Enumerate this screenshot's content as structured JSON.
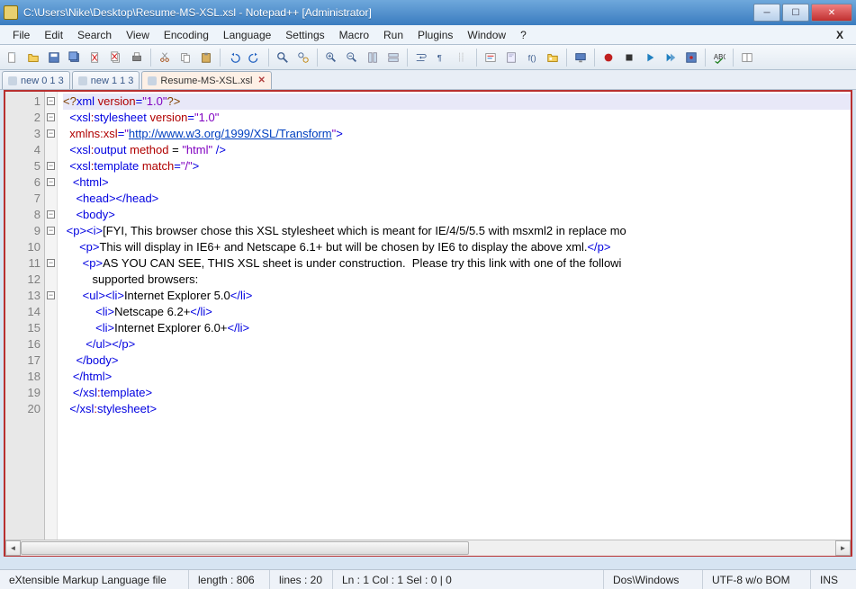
{
  "window": {
    "title": "C:\\Users\\Nike\\Desktop\\Resume-MS-XSL.xsl - Notepad++ [Administrator]"
  },
  "menu": {
    "items": [
      "File",
      "Edit",
      "Search",
      "View",
      "Encoding",
      "Language",
      "Settings",
      "Macro",
      "Run",
      "Plugins",
      "Window",
      "?"
    ]
  },
  "toolbar_icons": [
    "new-file-icon",
    "open-folder-icon",
    "save-icon",
    "save-all-icon",
    "close-icon",
    "close-all-icon",
    "print-icon",
    "sep",
    "cut-icon",
    "copy-icon",
    "paste-icon",
    "sep",
    "undo-icon",
    "redo-icon",
    "sep",
    "find-icon",
    "replace-icon",
    "sep",
    "zoom-in-icon",
    "zoom-out-icon",
    "sync-v-icon",
    "sync-h-icon",
    "sep",
    "wrap-icon",
    "all-chars-icon",
    "indent-guide-icon",
    "sep",
    "lang-icon",
    "doc-map-icon",
    "func-list-icon",
    "folder-view-icon",
    "sep",
    "monitor-icon",
    "sep",
    "record-icon",
    "stop-icon",
    "play-icon",
    "play-multi-icon",
    "save-macro-icon",
    "sep",
    "spellcheck-icon",
    "sep",
    "doc-switch-icon"
  ],
  "tabs": [
    {
      "label": "new 0 1 3",
      "dirty": false,
      "active": false
    },
    {
      "label": "new 1 1 3",
      "dirty": false,
      "active": false
    },
    {
      "label": "Resume-MS-XSL.xsl",
      "dirty": false,
      "active": true
    }
  ],
  "code_lines": [
    {
      "n": 1,
      "fold": "-",
      "segs": [
        [
          "brown",
          "<?"
        ],
        [
          "blue",
          "xml "
        ],
        [
          "red",
          "version"
        ],
        [
          "blue",
          "="
        ],
        [
          "purple",
          "\"1.0\""
        ],
        [
          "brown",
          "?>"
        ]
      ]
    },
    {
      "n": 2,
      "fold": "-",
      "segs": [
        [
          "black",
          "  "
        ],
        [
          "blue",
          "<"
        ],
        [
          "blue",
          "xsl"
        ],
        [
          "red",
          ":"
        ],
        [
          "blue",
          "stylesheet "
        ],
        [
          "red",
          "version"
        ],
        [
          "blue",
          "="
        ],
        [
          "purple",
          "\"1.0\""
        ]
      ]
    },
    {
      "n": 3,
      "fold": "-",
      "segs": [
        [
          "black",
          "  "
        ],
        [
          "red",
          "xmlns:xsl"
        ],
        [
          "blue",
          "="
        ],
        [
          "purple",
          "\""
        ],
        [
          "link",
          "http://www.w3.org/1999/XSL/Transform"
        ],
        [
          "purple",
          "\""
        ],
        [
          "blue",
          ">"
        ]
      ]
    },
    {
      "n": 4,
      "fold": "",
      "segs": [
        [
          "black",
          "  "
        ],
        [
          "blue",
          "<"
        ],
        [
          "blue",
          "xsl"
        ],
        [
          "red",
          ":"
        ],
        [
          "blue",
          "output "
        ],
        [
          "red",
          "method"
        ],
        [
          "black",
          " = "
        ],
        [
          "purple",
          "\"html\""
        ],
        [
          "blue",
          " />"
        ]
      ]
    },
    {
      "n": 5,
      "fold": "-",
      "segs": [
        [
          "black",
          "  "
        ],
        [
          "blue",
          "<"
        ],
        [
          "blue",
          "xsl"
        ],
        [
          "red",
          ":"
        ],
        [
          "blue",
          "template "
        ],
        [
          "red",
          "match"
        ],
        [
          "blue",
          "="
        ],
        [
          "purple",
          "\"/\""
        ],
        [
          "blue",
          ">"
        ]
      ]
    },
    {
      "n": 6,
      "fold": "-",
      "segs": [
        [
          "black",
          "   "
        ],
        [
          "blue",
          "<html>"
        ]
      ]
    },
    {
      "n": 7,
      "fold": "",
      "segs": [
        [
          "black",
          "    "
        ],
        [
          "blue",
          "<head></head>"
        ]
      ]
    },
    {
      "n": 8,
      "fold": "-",
      "segs": [
        [
          "black",
          "    "
        ],
        [
          "blue",
          "<body>"
        ]
      ]
    },
    {
      "n": 9,
      "fold": "-",
      "segs": [
        [
          "black",
          " "
        ],
        [
          "blue",
          "<p><i>"
        ],
        [
          "black",
          "[FYI, This browser chose this XSL "
        ],
        [
          "black",
          "stylesheet"
        ],
        [
          "black",
          " which is meant for IE/4/5/5.5 with msxml2 in replace mo"
        ]
      ]
    },
    {
      "n": 10,
      "fold": "",
      "segs": [
        [
          "black",
          "     "
        ],
        [
          "blue",
          "<p>"
        ],
        [
          "black",
          "This will display in IE6+ and Netscape 6.1+ but will be chosen by IE6 to display the above "
        ],
        [
          "black",
          "xml"
        ],
        [
          "black",
          "."
        ],
        [
          "blue",
          "</p>"
        ]
      ]
    },
    {
      "n": 11,
      "fold": "-",
      "segs": [
        [
          "black",
          "      "
        ],
        [
          "blue",
          "<p>"
        ],
        [
          "black",
          "AS YOU CAN SEE, THIS XSL sheet is under construction.  Please try this link with one of the followi"
        ]
      ]
    },
    {
      "n": 12,
      "fold": "",
      "segs": [
        [
          "black",
          "         supported browsers:"
        ]
      ]
    },
    {
      "n": 13,
      "fold": "-",
      "segs": [
        [
          "black",
          "      "
        ],
        [
          "blue",
          "<ul><li>"
        ],
        [
          "black",
          "Internet Explorer 5.0"
        ],
        [
          "blue",
          "</li>"
        ]
      ]
    },
    {
      "n": 14,
      "fold": "",
      "segs": [
        [
          "black",
          "          "
        ],
        [
          "blue",
          "<li>"
        ],
        [
          "black",
          "Netscape 6.2+"
        ],
        [
          "blue",
          "</li>"
        ]
      ]
    },
    {
      "n": 15,
      "fold": "",
      "segs": [
        [
          "black",
          "          "
        ],
        [
          "blue",
          "<li>"
        ],
        [
          "black",
          "Internet Explorer 6.0+"
        ],
        [
          "blue",
          "</li>"
        ]
      ]
    },
    {
      "n": 16,
      "fold": "",
      "segs": [
        [
          "black",
          "       "
        ],
        [
          "blue",
          "</ul></p>"
        ]
      ]
    },
    {
      "n": 17,
      "fold": "",
      "segs": [
        [
          "black",
          "    "
        ],
        [
          "blue",
          "</body>"
        ]
      ]
    },
    {
      "n": 18,
      "fold": "",
      "segs": [
        [
          "black",
          "   "
        ],
        [
          "blue",
          "</html>"
        ]
      ]
    },
    {
      "n": 19,
      "fold": "",
      "segs": [
        [
          "black",
          "   "
        ],
        [
          "blue",
          "</"
        ],
        [
          "blue",
          "xsl"
        ],
        [
          "red",
          ":"
        ],
        [
          "blue",
          "template>"
        ]
      ]
    },
    {
      "n": 20,
      "fold": "",
      "segs": [
        [
          "black",
          "  "
        ],
        [
          "blue",
          "</"
        ],
        [
          "blue",
          "xsl"
        ],
        [
          "red",
          ":"
        ],
        [
          "blue",
          "stylesheet>"
        ]
      ]
    }
  ],
  "status": {
    "filetype": "eXtensible Markup Language file",
    "length": "length : 806",
    "lines": "lines : 20",
    "pos": "Ln : 1   Col : 1   Sel : 0 | 0",
    "eol": "Dos\\Windows",
    "enc": "UTF-8 w/o BOM",
    "ins": "INS"
  }
}
